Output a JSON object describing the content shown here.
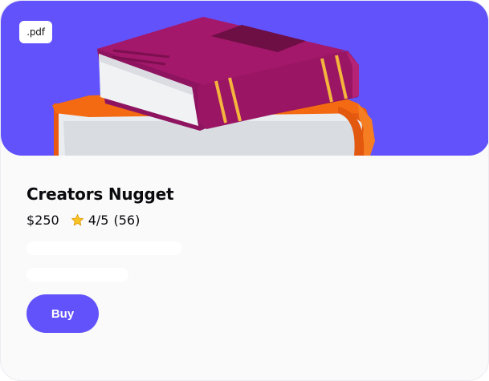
{
  "product": {
    "format_badge": ".pdf",
    "title": "Creators Nugget",
    "price": "$250",
    "rating": "4/5",
    "review_count": "(56)",
    "star_icon": "star-icon",
    "cover_icon": "books-stack-illustration"
  },
  "actions": {
    "buy_label": "Buy"
  },
  "colors": {
    "accent": "#6152fb",
    "card_bg": "#fafafa",
    "top_book": "#a3186a",
    "bottom_book": "#f36a12",
    "book_stripes": "#f4b43d"
  }
}
